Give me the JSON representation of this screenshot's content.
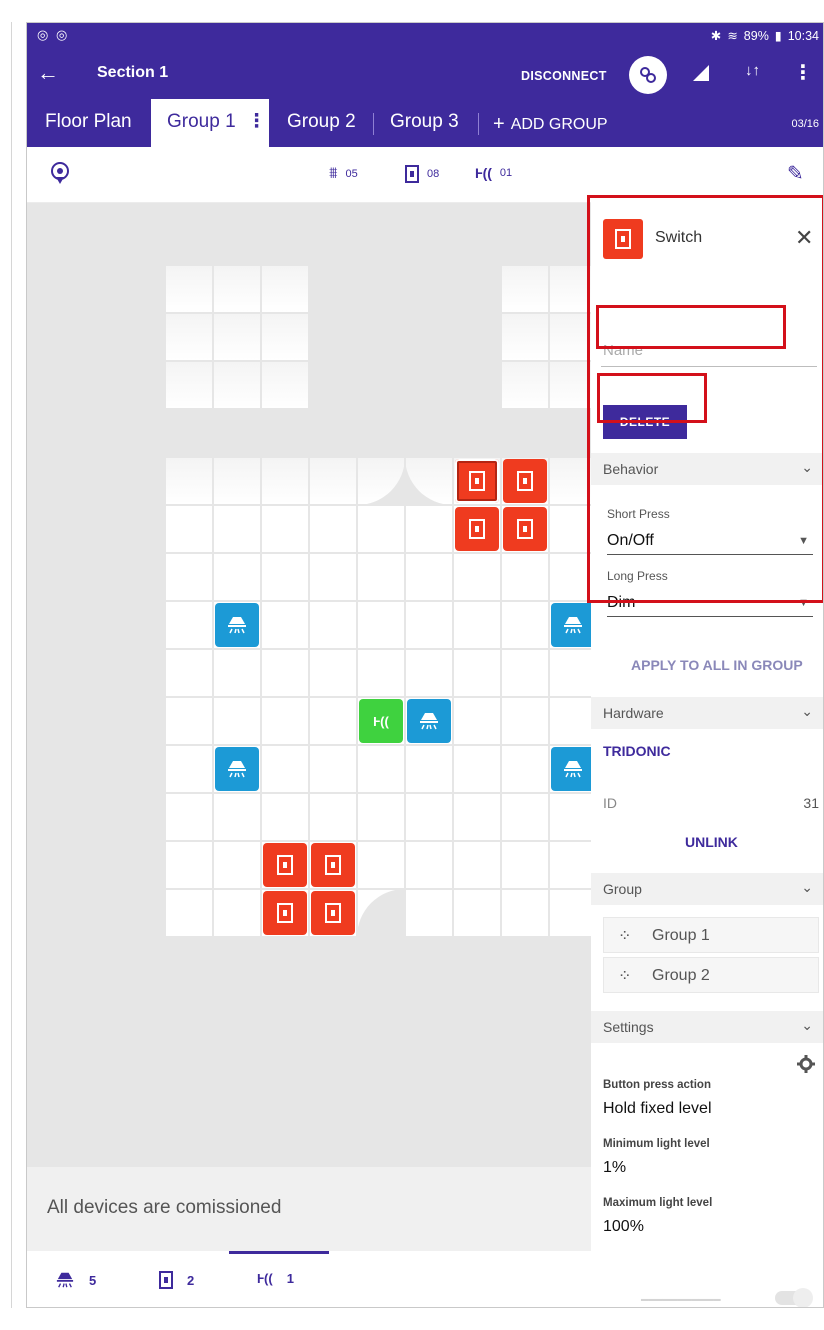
{
  "status_bar": {
    "left_icons": "◎ ◎",
    "battery": "89%",
    "time": "10:34"
  },
  "app_bar": {
    "title": "Section 1",
    "disconnect_label": "DISCONNECT"
  },
  "tabs": {
    "items": [
      "Floor Plan",
      "Group 1",
      "Group 2",
      "Group 3"
    ],
    "active_index": 1,
    "add_group_label": "ADD GROUP",
    "pager": "03/16"
  },
  "toolbar": {
    "luminaire_count": "05",
    "switch_count": "08",
    "sensor_count": "01"
  },
  "footer": {
    "message": "All devices are comissioned",
    "luminaire_count": "5",
    "switch_count": "2",
    "sensor_count": "1"
  },
  "panel": {
    "title": "Switch",
    "name_placeholder": "Name",
    "delete_label": "DELETE",
    "behavior": {
      "header": "Behavior",
      "short_press_label": "Short Press",
      "short_press_value": "On/Off",
      "long_press_label": "Long Press",
      "long_press_value": "Dim"
    },
    "apply_label": "APPLY TO ALL IN GROUP",
    "hardware": {
      "header": "Hardware",
      "vendor": "TRIDONIC",
      "id_label": "ID",
      "id_value": "31",
      "unlink_label": "UNLINK"
    },
    "group": {
      "header": "Group",
      "items": [
        "Group 1",
        "Group 2"
      ]
    },
    "settings": {
      "header": "Settings",
      "button_press_label": "Button press action",
      "button_press_value": "Hold fixed level",
      "min_label": "Minimum light level",
      "min_value": "1%",
      "max_label": "Maximum light level",
      "max_value": "100%"
    }
  },
  "colors": {
    "primary": "#3e2a9c",
    "switch_red": "#ef3b1f",
    "luminaire_blue": "#1c9ad6",
    "sensor_green": "#3fd23f",
    "highlight_red": "#d3101a"
  }
}
